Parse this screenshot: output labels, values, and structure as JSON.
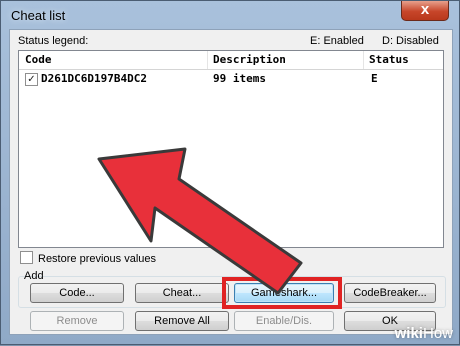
{
  "window": {
    "title": "Cheat list",
    "close_glyph": "x"
  },
  "legend": {
    "label": "Status legend:",
    "enabled": "E: Enabled",
    "disabled": "D: Disabled"
  },
  "list": {
    "columns": [
      "Code",
      "Description",
      "Status"
    ],
    "rows": [
      {
        "checked": true,
        "code": "D261DC6D197B4DC2",
        "description": "99 items",
        "status": "E"
      }
    ]
  },
  "restore_label": "Restore previous values",
  "add": {
    "label": "Add",
    "buttons": [
      "Code...",
      "Cheat...",
      "Gameshark...",
      "CodeBreaker..."
    ]
  },
  "bottom_buttons": {
    "remove": "Remove",
    "remove_all": "Remove All",
    "enable_dis": "Enable/Dis.",
    "ok": "OK"
  },
  "annotation": {
    "arrow_color": "#e8303a",
    "highlight_color": "#e02323"
  },
  "watermark": {
    "wiki": "wiki",
    "how": "How"
  }
}
